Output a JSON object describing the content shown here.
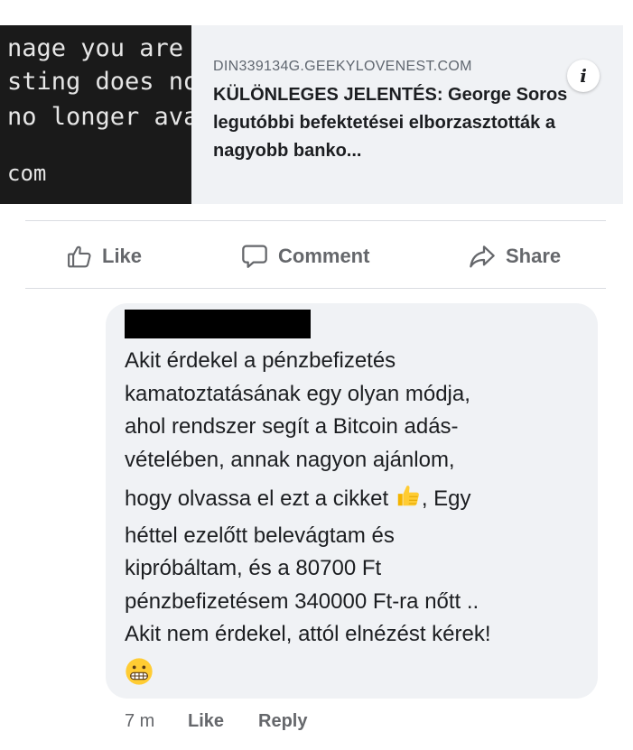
{
  "link_preview": {
    "thumbnail_lines": [
      "nage you are",
      "sting does no",
      "no longer avail",
      "com"
    ],
    "domain": "DIN339134G.GEEKYLOVENEST.COM",
    "title": "KÜLÖNLEGES JELENTÉS: George Soros legutóbbi befektetései elborzasztották a nagyobb banko...",
    "info_icon": "info-icon"
  },
  "actions": {
    "like": "Like",
    "comment": "Comment",
    "share": "Share"
  },
  "comment": {
    "author_redacted": true,
    "lines": [
      "Akit érdekel a pénzbefizetés",
      "kamatoztatásának egy olyan módja,",
      "ahol rendszer segít a Bitcoin adás-",
      "vételében, annak nagyon ajánlom,",
      "hogy olvassa el ezt a cikket",
      ", Egy",
      "héttel ezelőtt belevágtam és",
      "kipróbáltam, és a 80700 Ft",
      "pénzbefizetésem 340000 Ft-ra nőtt ..",
      "Akit nem érdekel, attól elnézést kérek!"
    ],
    "emojis": [
      "thumbs-up-emoji",
      "grimacing-face-emoji"
    ],
    "timestamp": "7 m",
    "like_label": "Like",
    "reply_label": "Reply"
  },
  "colors": {
    "card_bg": "#f0f2f5",
    "text_primary": "#1c1e21",
    "text_secondary": "#65676b",
    "divider": "#dadde1"
  }
}
